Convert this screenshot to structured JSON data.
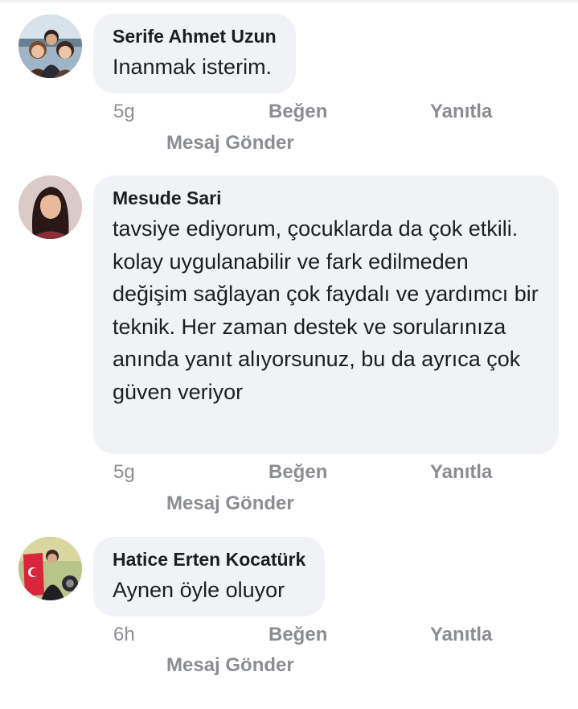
{
  "comments": [
    {
      "author": "Serife Ahmet Uzun",
      "text": "Inanmak isterim.",
      "time": "5g",
      "like_label": "Beğen",
      "reply_label": "Yanıtla",
      "message_label": "Mesaj Gönder",
      "avatar_icon": "group-photo-avatar"
    },
    {
      "author": "Mesude Sari",
      "text": "tavsiye ediyorum, çocuklarda da çok etkili. kolay uygulanabilir ve fark edilmeden değişim sağlayan çok faydalı ve yardımcı bir teknik. Her zaman destek ve sorularınıza anında yanıt alıyorsunuz, bu da ayrıca çok güven veriyor",
      "time": "5g",
      "like_label": "Beğen",
      "reply_label": "Yanıtla",
      "message_label": "Mesaj Gönder",
      "avatar_icon": "portrait-avatar"
    },
    {
      "author": "Hatice Erten Kocatürk",
      "text": "Aynen öyle oluyor",
      "time": "6h",
      "like_label": "Beğen",
      "reply_label": "Yanıtla",
      "message_label": "Mesaj Gönder",
      "avatar_icon": "flag-photo-avatar"
    }
  ],
  "colors": {
    "bubble": "#f0f2f5",
    "text": "#1c1e21",
    "meta": "#8a8d91"
  }
}
